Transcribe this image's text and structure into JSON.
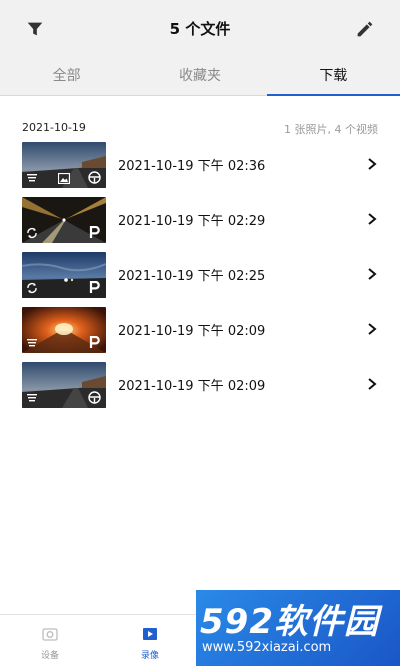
{
  "header": {
    "title": "5 个文件",
    "filter_icon": "filter-icon",
    "edit_icon": "pencil-icon"
  },
  "tabs": [
    {
      "label": "全部",
      "active": false
    },
    {
      "label": "收藏夹",
      "active": false
    },
    {
      "label": "下载",
      "active": true
    }
  ],
  "section": {
    "date": "2021-10-19",
    "summary": "1 张照片, 4 个视频"
  },
  "files": [
    {
      "label": "2021-10-19 下午 02:36",
      "scene": "dusk-road",
      "icons": [
        "list-icon",
        "photo-icon",
        "steering-wheel-icon"
      ]
    },
    {
      "label": "2021-10-19 下午 02:29",
      "scene": "night-highway",
      "icons": [
        "loop-icon",
        "parking-icon"
      ]
    },
    {
      "label": "2021-10-19 下午 02:25",
      "scene": "evening-sky",
      "icons": [
        "loop-icon",
        "parking-icon"
      ]
    },
    {
      "label": "2021-10-19 下午 02:09",
      "scene": "tunnel",
      "icons": [
        "list-icon",
        "parking-icon"
      ]
    },
    {
      "label": "2021-10-19 下午 02:09",
      "scene": "dusk-road",
      "icons": [
        "list-icon",
        "steering-wheel-icon"
      ]
    }
  ],
  "bottom_nav": [
    {
      "label": "设备",
      "icon": "camera-icon",
      "active": false
    },
    {
      "label": "录像",
      "icon": "play-icon",
      "active": true
    },
    {
      "label": "",
      "icon": "",
      "active": false
    },
    {
      "label": "",
      "icon": "",
      "active": false
    }
  ],
  "watermark": {
    "brand": "592软件园",
    "url": "www.592xiazai.com"
  },
  "colors": {
    "accent": "#1f5fcf",
    "header_bg": "#f1f1f1",
    "muted_text": "#9a9a9a"
  }
}
